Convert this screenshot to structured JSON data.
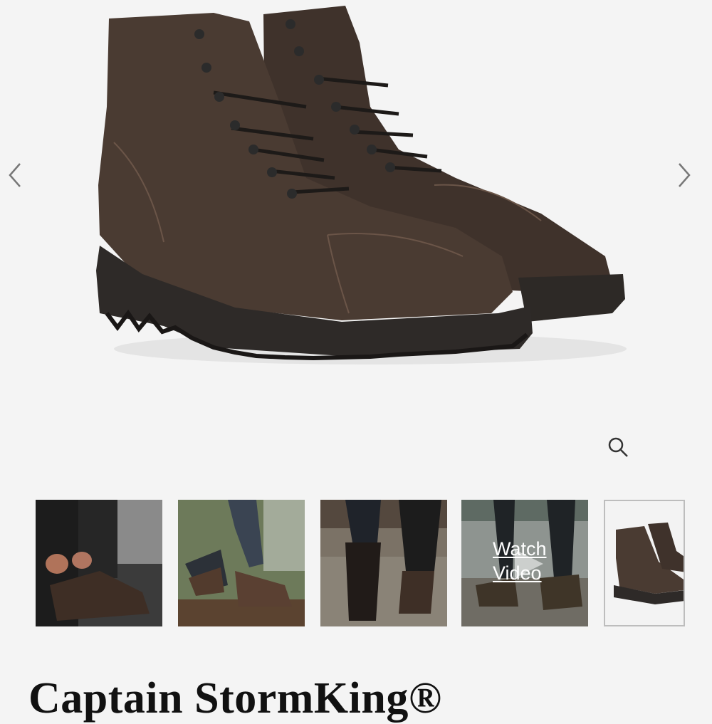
{
  "product": {
    "title": "Captain StormKing®"
  },
  "gallery": {
    "hero_alt": "Captain StormKing boots, brown leather, cap toe",
    "prev_icon": "chevron-left-icon",
    "next_icon": "chevron-right-icon",
    "zoom_icon": "magnifier-icon",
    "thumbnails": [
      {
        "kind": "photo",
        "subject": "lacing-boots"
      },
      {
        "kind": "photo",
        "subject": "walking-on-log"
      },
      {
        "kind": "photo",
        "subject": "sole-view"
      },
      {
        "kind": "video",
        "label": "Watch Video"
      },
      {
        "kind": "photo",
        "subject": "product-pair",
        "selected": true
      }
    ]
  },
  "colors": {
    "background": "#f4f4f4",
    "leather": "#4a3b32",
    "sole": "#2e2a28",
    "text": "#111111"
  }
}
